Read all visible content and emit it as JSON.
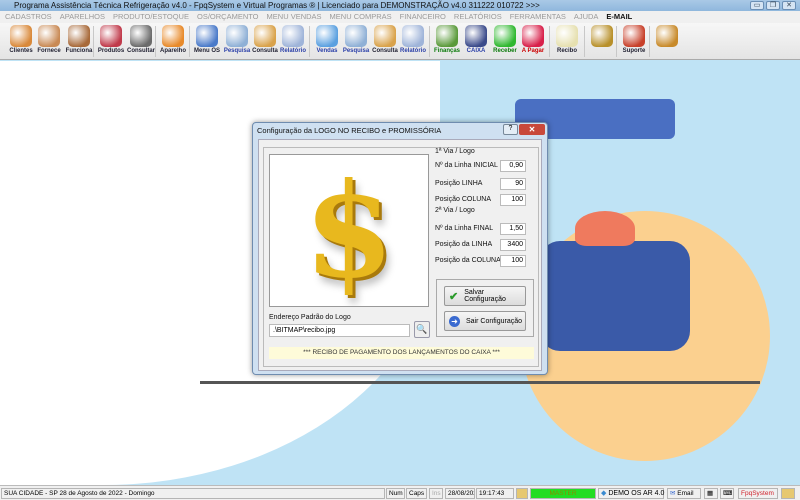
{
  "window": {
    "title": "Programa Assistência Técnica Refrigeração v4.0 - FpqSystem e Virtual Programas ® | Licenciado para  DEMONSTRAÇÃO v4.0 311222 010722 >>>",
    "buttons": [
      "▭",
      "❐",
      "✕"
    ]
  },
  "menu": [
    "CADASTROS",
    "APARELHOS",
    "PRODUTO/ESTOQUE",
    "OS/ORÇAMENTO",
    "MENU VENDAS",
    "MENU COMPRAS",
    "FINANCEIRO",
    "RELATÓRIOS",
    "FERRAMENTAS",
    "AJUDA"
  ],
  "menu_email": "E-MAIL",
  "toolbar": [
    {
      "label": "Clientes",
      "icon": "people-icon",
      "color": "#d9893a",
      "style": ""
    },
    {
      "label": "Fornece",
      "icon": "supplier-icon",
      "color": "#c98a55",
      "style": ""
    },
    {
      "label": "Funciona",
      "icon": "employee-icon",
      "color": "#a86a3a",
      "style": ""
    },
    {
      "label": "Produtos",
      "icon": "products-icon",
      "color": "#c0394a",
      "style": ""
    },
    {
      "label": "Consultar",
      "icon": "barcode-icon",
      "color": "#6b6b6b",
      "style": ""
    },
    {
      "label": "Aparelho",
      "icon": "appliance-icon",
      "color": "#e88a2a",
      "style": ""
    },
    {
      "label": "Menu OS",
      "icon": "tools-icon",
      "color": "#4a7ac9",
      "style": ""
    },
    {
      "label": "Pesquisa",
      "icon": "search-doc-icon",
      "color": "#8fb0d6",
      "style": "blue"
    },
    {
      "label": "Consulta",
      "icon": "folder-icon",
      "color": "#d9a24a",
      "style": ""
    },
    {
      "label": "Relatório",
      "icon": "printer-icon",
      "color": "#9fb4d9",
      "style": "blue"
    },
    {
      "label": "Vendas",
      "icon": "monitor-icon",
      "color": "#5aa0e0",
      "style": "blue"
    },
    {
      "label": "Pesquisa",
      "icon": "search-doc-icon",
      "color": "#8fb0d6",
      "style": "blue"
    },
    {
      "label": "Consulta",
      "icon": "folder-icon",
      "color": "#d9a24a",
      "style": ""
    },
    {
      "label": "Relatório",
      "icon": "printer-icon",
      "color": "#9fb4d9",
      "style": "blue"
    },
    {
      "label": "Finanças",
      "icon": "finance-chart-icon",
      "color": "#5a9a3a",
      "style": "green"
    },
    {
      "label": "CAIXA",
      "icon": "cashbook-icon",
      "color": "#3a4a8a",
      "style": "blue"
    },
    {
      "label": "Receber",
      "icon": "dollar-green-icon",
      "color": "#2fb82f",
      "style": "green"
    },
    {
      "label": "A Pagar",
      "icon": "dollar-red-icon",
      "color": "#d8204a",
      "style": "red"
    },
    {
      "label": "Recibo",
      "icon": "receipt-icon",
      "color": "#e6e0b0",
      "style": ""
    },
    {
      "label": "",
      "icon": "coin-icon",
      "color": "#b8902a",
      "style": ""
    },
    {
      "label": "Suporte",
      "icon": "support-icon",
      "color": "#c8402a",
      "style": ""
    },
    {
      "label": "",
      "icon": "exit-door-icon",
      "color": "#c88a2a",
      "style": ""
    }
  ],
  "dialog": {
    "title": "Configuração da LOGO NO RECIBO e PROMISSÓRIA",
    "help": "?",
    "close": "✕",
    "group1": {
      "title": "1ª Via / Logo",
      "fields": [
        {
          "label": "Nº da Linha INICIAL",
          "value": "0,90"
        },
        {
          "label": "Posição LINHA",
          "value": "90"
        },
        {
          "label": "Posição COLUNA",
          "value": "100"
        }
      ]
    },
    "group2": {
      "title": "2ª Via / Logo",
      "fields": [
        {
          "label": "Nº da Linha FINAL",
          "value": "1,50"
        },
        {
          "label": "Posição da LINHA",
          "value": "3400"
        },
        {
          "label": "Posição da COLUNA",
          "value": "100"
        }
      ]
    },
    "save_label": "Salvar Configuração",
    "exit_label": "Sair Configuração",
    "path_label": "Endereço Padrão do Logo",
    "path_value": ".\\BITMAP\\recibo.jpg",
    "banner": "*** RECIBO DE PAGAMENTO DOS LANÇAMENTOS DO CAIXA ***",
    "logo_glyph": "$"
  },
  "status": {
    "city": "SUA CIDADE - SP 28 de Agosto de 2022 - Domingo",
    "num": "Num",
    "caps": "Caps",
    "ins": "Ins",
    "date": "28/08/2022",
    "time": "19:17:43",
    "user": "MASTER",
    "user_color": "#22dd22",
    "version": "DEMO OS AR 4.0",
    "email": "Email",
    "brand": "FpqSystem",
    "brand_color": "#d0202a"
  }
}
